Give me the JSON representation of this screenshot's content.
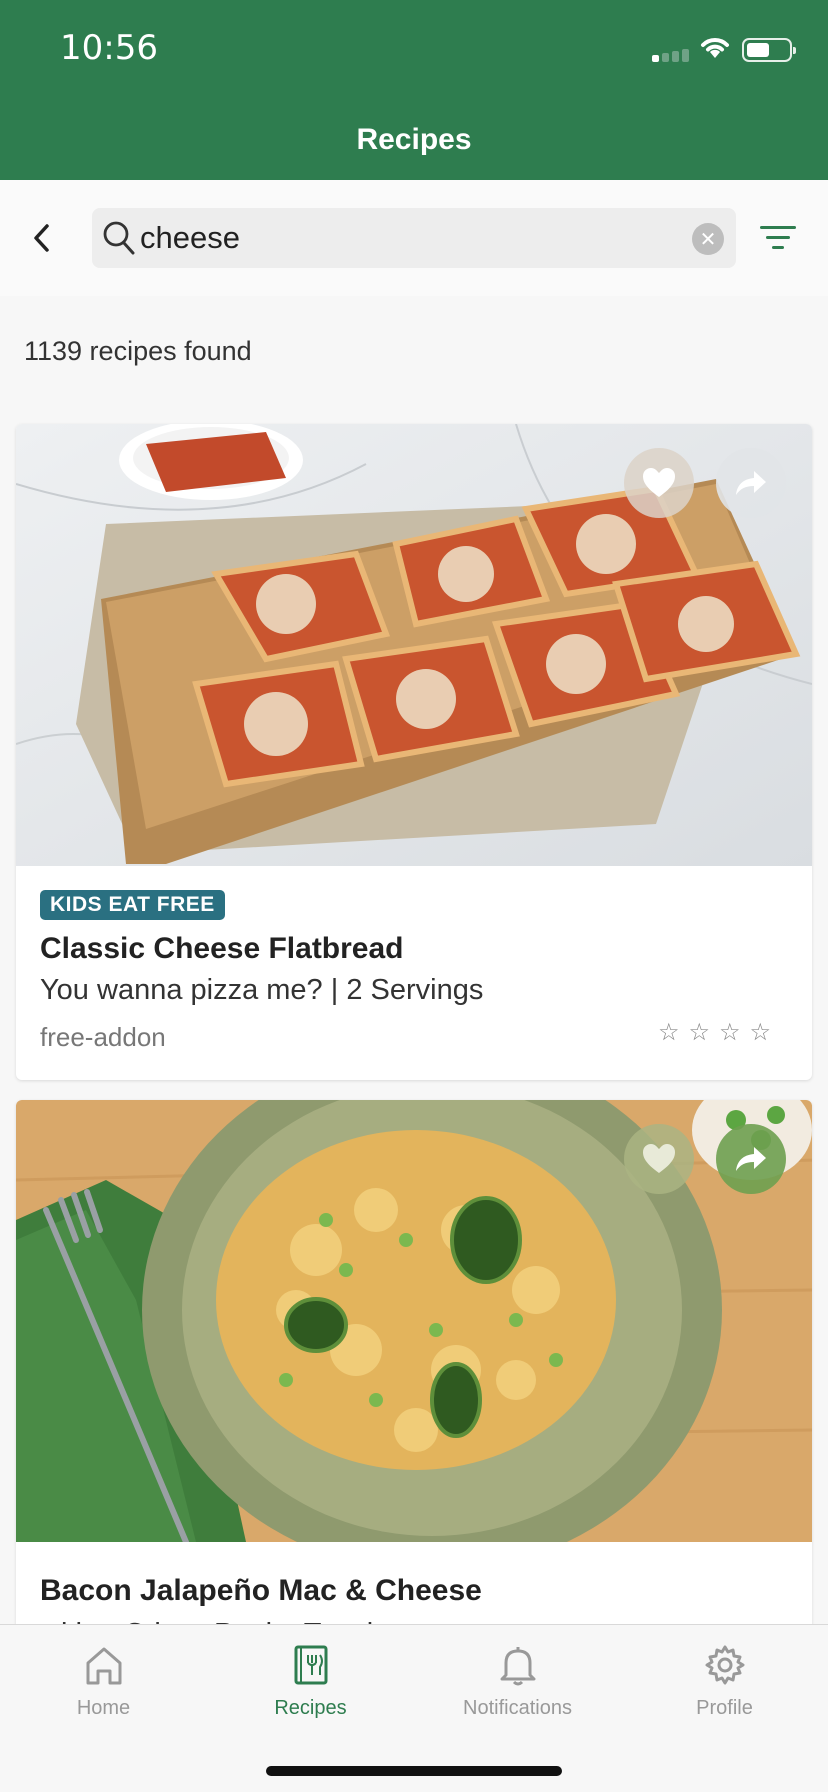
{
  "status_bar": {
    "time": "10:56"
  },
  "header": {
    "title": "Recipes"
  },
  "search": {
    "value": "cheese",
    "placeholder": ""
  },
  "results": {
    "count_text": "1139 recipes found"
  },
  "recipes": [
    {
      "badge": "KIDS EAT FREE",
      "title": "Classic Cheese Flatbread",
      "subtitle": "You wanna pizza me? | 2 Servings",
      "tag": "free-addon",
      "rating_stars": 0
    },
    {
      "title": "Bacon Jalapeño Mac & Cheese",
      "subtitle": "with a Crispy Panko Topping"
    }
  ],
  "tab_bar": {
    "items": [
      {
        "label": "Home",
        "icon": "home-icon"
      },
      {
        "label": "Recipes",
        "icon": "recipes-book-icon",
        "active": true
      },
      {
        "label": "Notifications",
        "icon": "bell-icon"
      },
      {
        "label": "Profile",
        "icon": "gear-icon"
      }
    ]
  },
  "colors": {
    "brand_green": "#2e7d4f",
    "badge_teal": "#2a7081"
  }
}
